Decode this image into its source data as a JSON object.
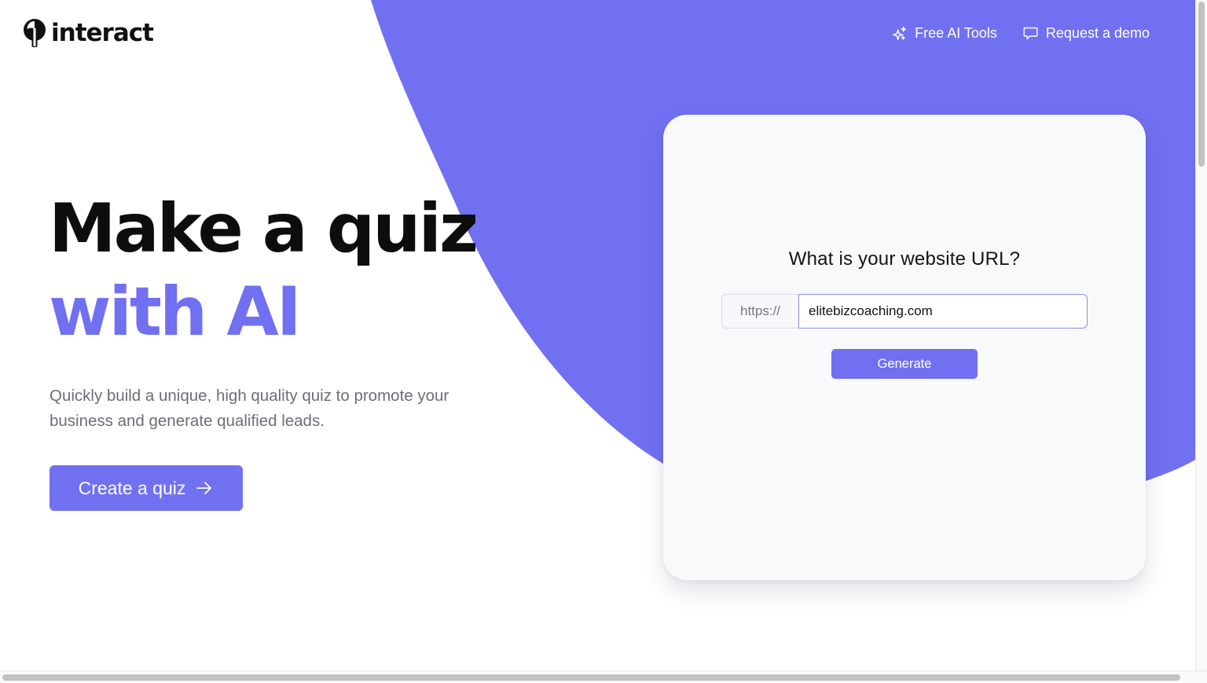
{
  "brand": {
    "name": "interact",
    "accent_color": "#7170f1"
  },
  "nav": {
    "items": [
      {
        "label": "Free AI Tools",
        "icon": "sparkles-icon"
      },
      {
        "label": "Request a demo",
        "icon": "chat-bubble-icon"
      }
    ]
  },
  "hero": {
    "title_line1": "Make a quiz",
    "title_line2": "with AI",
    "subtitle": "Quickly build a unique, high quality quiz to promote your business and generate qualified leads.",
    "cta_label": "Create a quiz",
    "cta_icon": "arrow-right-icon"
  },
  "card": {
    "question": "What is your website URL?",
    "url_prefix": "https://",
    "url_value": "elitebizcoaching.com",
    "generate_label": "Generate"
  }
}
